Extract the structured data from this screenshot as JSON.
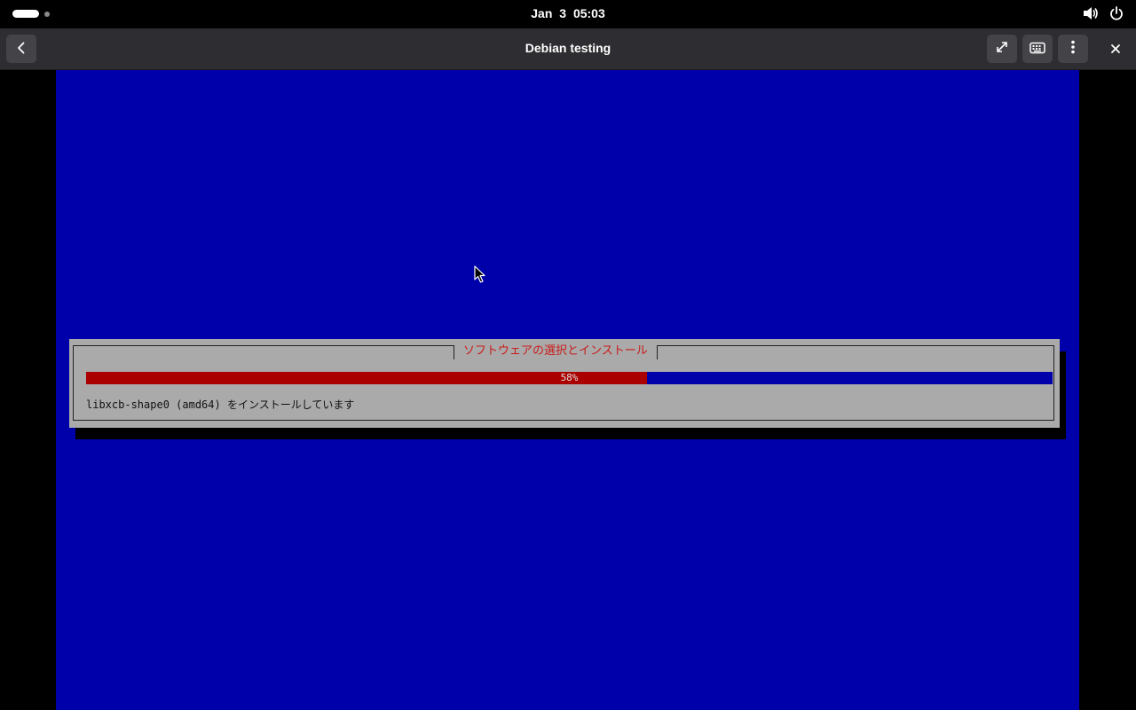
{
  "topbar": {
    "clock": "Jan 3  05:03",
    "icons": [
      "activities-indicator",
      "volume-icon",
      "power-icon"
    ]
  },
  "headerbar": {
    "title": "Debian testing",
    "icons": [
      "back-arrow-icon",
      "fullscreen-icon",
      "keyboard-icon",
      "kebab-menu-icon",
      "close-icon"
    ]
  },
  "installer": {
    "dialog_title": "ソフトウェアの選択とインストール",
    "progress_label": "58%",
    "progress_fraction": 0.58,
    "status_text": "libxcb-shape0 (amd64) をインストールしています"
  },
  "colors": {
    "screen_bg": "#0000aa",
    "dialog_bg": "#aaaaaa",
    "progress_fill": "#aa0000",
    "title_text": "#cc1a1a",
    "header_bg": "#2e2e32"
  }
}
